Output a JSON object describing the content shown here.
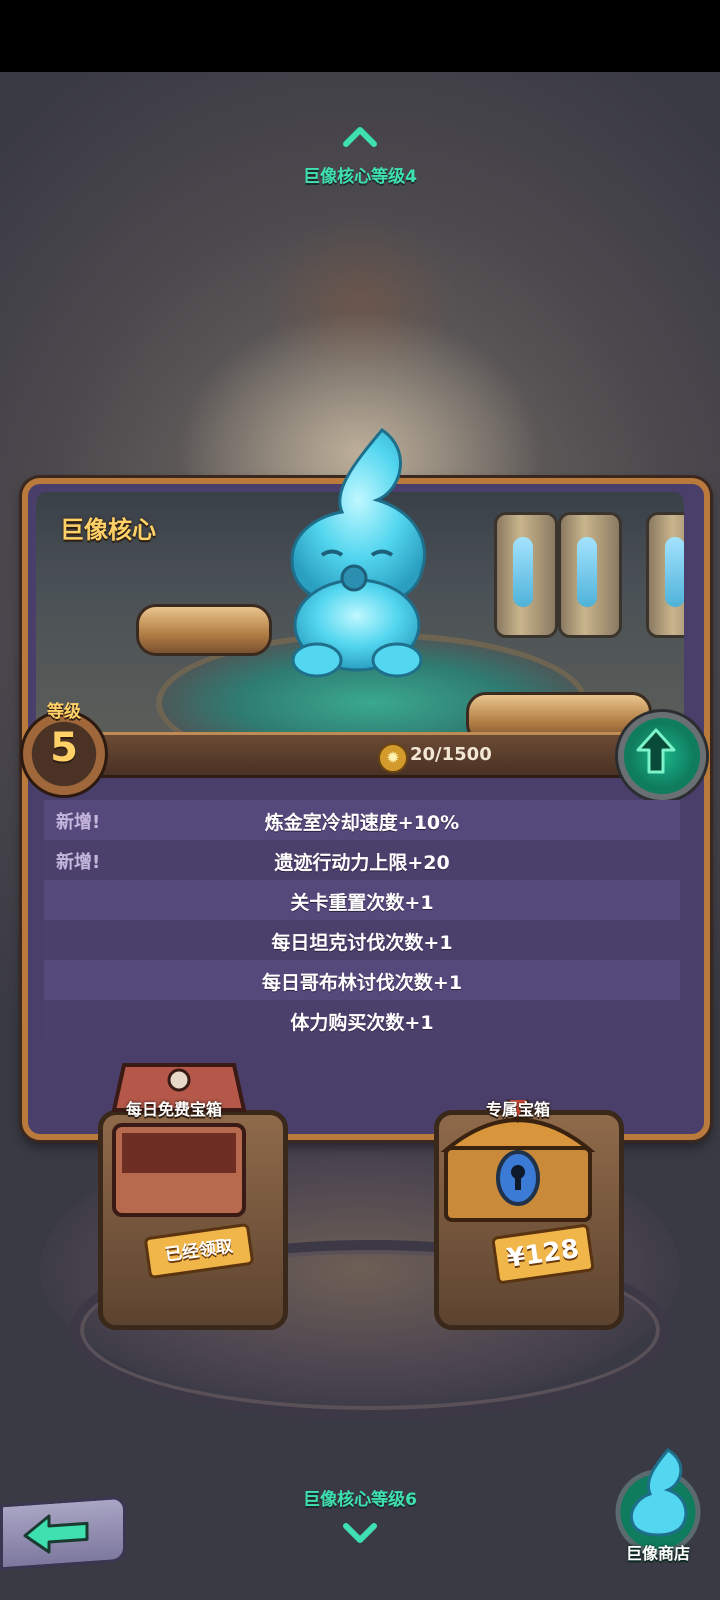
{
  "nav": {
    "prev_level_label": "巨像核心等级4",
    "next_level_label": "巨像核心等级6"
  },
  "card": {
    "title": "巨像核心",
    "level_label": "等级",
    "level_value": "5",
    "xp_text": "20/1500",
    "xp_progress": 0.013
  },
  "bonuses": [
    {
      "tag": "新增!",
      "text": "炼金室冷却速度+10%"
    },
    {
      "tag": "新增!",
      "text": "遗迹行动力上限+20"
    },
    {
      "tag": "",
      "text": "关卡重置次数+1"
    },
    {
      "tag": "",
      "text": "每日坦克讨伐次数+1"
    },
    {
      "tag": "",
      "text": "每日哥布林讨伐次数+1"
    },
    {
      "tag": "",
      "text": "体力购买次数+1"
    }
  ],
  "chests": {
    "free": {
      "label": "每日免费宝箱",
      "status": "已经领取"
    },
    "exclusive": {
      "label": "专属宝箱",
      "price": "¥128"
    }
  },
  "shop": {
    "label": "巨像商店"
  },
  "colors": {
    "accent_green": "#3fe0b0",
    "title_gold": "#ffd166",
    "panel_purple": "#4a3e6a",
    "frame_orange": "#b97a3c"
  },
  "icons": {
    "prev": "chevron-up-icon",
    "next": "chevron-down-icon",
    "upgrade": "arrow-up-icon",
    "back": "arrow-left-icon",
    "xp": "sun-coin-icon"
  }
}
